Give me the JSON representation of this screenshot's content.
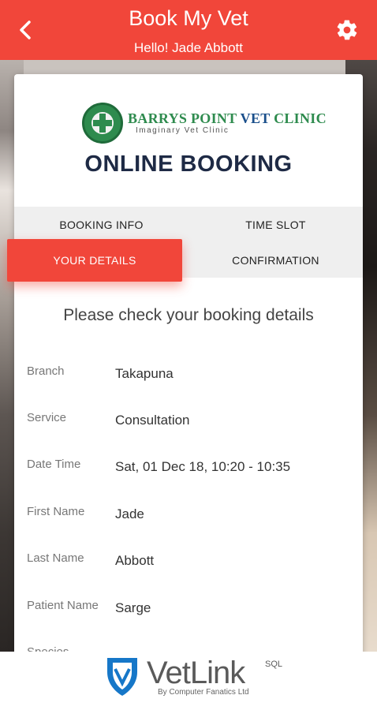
{
  "header": {
    "title": "Book My Vet",
    "greeting": "Hello! Jade Abbott",
    "back_icon": "chevron-left-icon",
    "settings_icon": "gear-icon",
    "color": "#f1463a"
  },
  "clinic": {
    "name_part1": "BARRYS POINT",
    "name_part2": "VET",
    "name_part3": "CLINIC",
    "tagline": "Imaginary Vet Clinic"
  },
  "page": {
    "title": "ONLINE BOOKING",
    "heading": "Please check your booking details"
  },
  "tabs": [
    {
      "label": "BOOKING INFO",
      "active": false
    },
    {
      "label": "TIME SLOT",
      "active": false
    },
    {
      "label": "YOUR DETAILS",
      "active": true
    },
    {
      "label": "CONFIRMATION",
      "active": false
    }
  ],
  "details": [
    {
      "label": "Branch",
      "value": "Takapuna"
    },
    {
      "label": "Service",
      "value": "Consultation"
    },
    {
      "label": "Date Time",
      "value": "Sat, 01 Dec 18, 10:20 - 10:35"
    },
    {
      "label": "First Name",
      "value": "Jade"
    },
    {
      "label": "Last Name",
      "value": "Abbott"
    },
    {
      "label": "Patient Name",
      "value": "Sarge"
    },
    {
      "label": "Species",
      "value": ""
    }
  ],
  "footer": {
    "brand": "VetLink",
    "suffix": "SQL",
    "byline": "By Computer Fanatics Ltd"
  }
}
